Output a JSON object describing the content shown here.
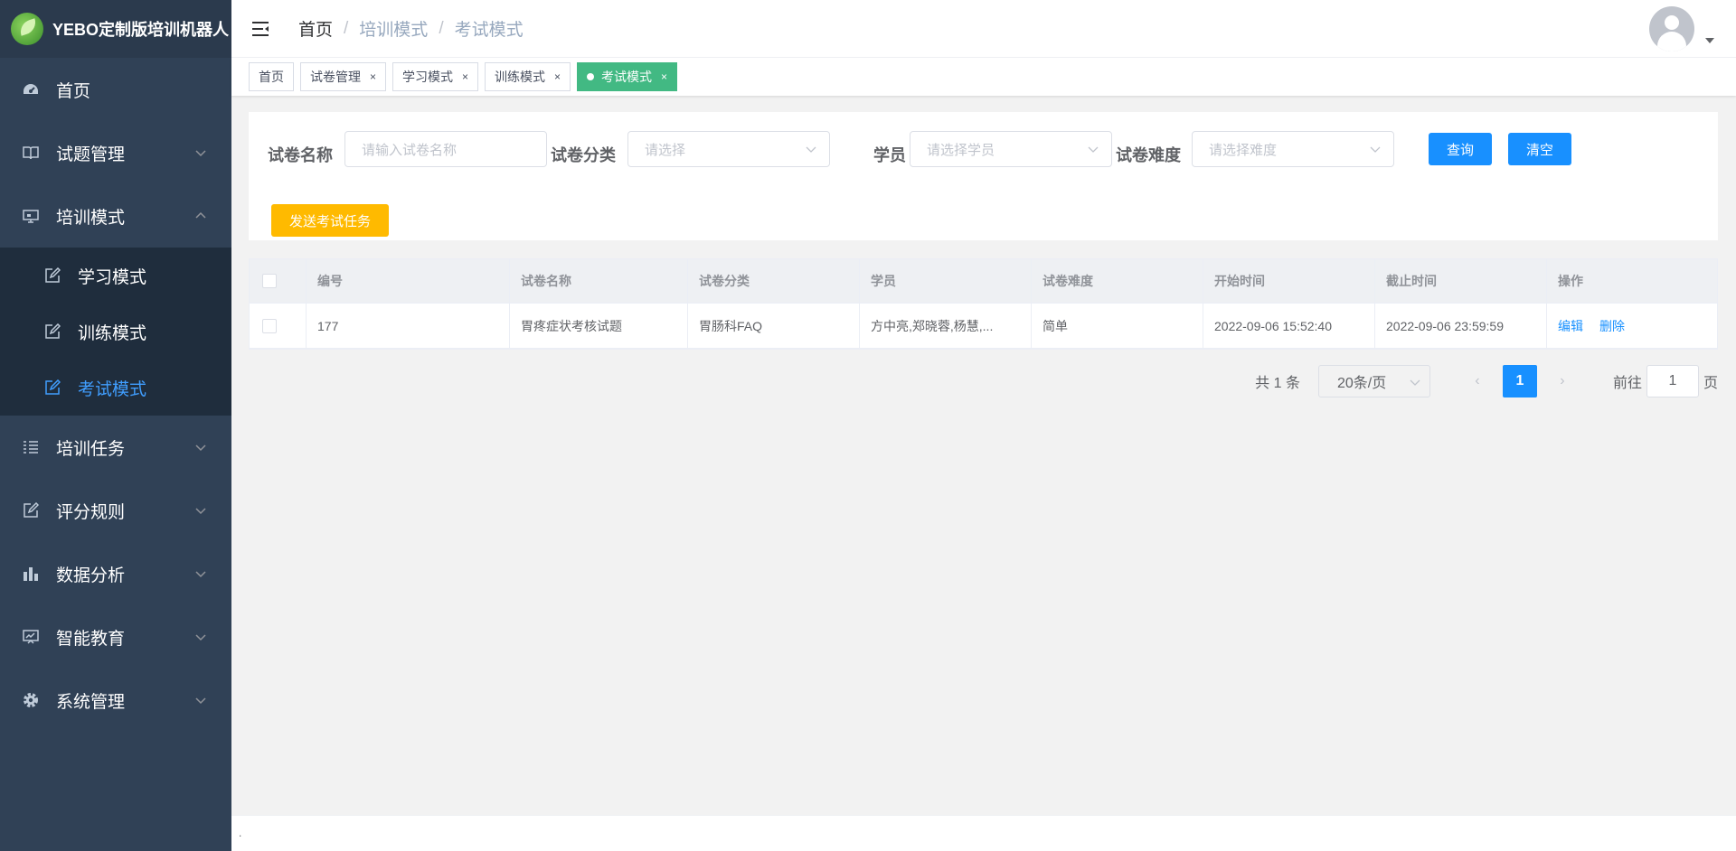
{
  "app": {
    "title": "YEBO定制版培训机器人"
  },
  "sidebar": {
    "items": [
      {
        "label": "首页",
        "icon": "dashboard-icon"
      },
      {
        "label": "试题管理",
        "icon": "book-icon"
      },
      {
        "label": "培训模式",
        "icon": "monitor-icon",
        "expanded": true,
        "children": [
          {
            "label": "学习模式",
            "icon": "edit-icon"
          },
          {
            "label": "训练模式",
            "icon": "edit-icon"
          },
          {
            "label": "考试模式",
            "icon": "edit-icon",
            "active": true
          }
        ]
      },
      {
        "label": "培训任务",
        "icon": "list-icon"
      },
      {
        "label": "评分规则",
        "icon": "edit-icon"
      },
      {
        "label": "数据分析",
        "icon": "bar-chart-icon"
      },
      {
        "label": "智能教育",
        "icon": "presentation-icon"
      },
      {
        "label": "系统管理",
        "icon": "gear-icon"
      }
    ]
  },
  "navbar": {
    "breadcrumb": [
      "首页",
      "培训模式",
      "考试模式"
    ],
    "separator": "/"
  },
  "tags": [
    {
      "label": "首页",
      "closable": false
    },
    {
      "label": "试卷管理",
      "closable": true
    },
    {
      "label": "学习模式",
      "closable": true
    },
    {
      "label": "训练模式",
      "closable": true
    },
    {
      "label": "考试模式",
      "closable": true,
      "active": true
    }
  ],
  "tag_close": "×",
  "filter": {
    "name_label": "试卷名称",
    "name_placeholder": "请输入试卷名称",
    "category_label": "试卷分类",
    "category_placeholder": "请选择",
    "student_label": "学员",
    "student_placeholder": "请选择学员",
    "difficulty_label": "试卷难度",
    "difficulty_placeholder": "请选择难度",
    "query_button": "查询",
    "clear_button": "清空",
    "send_button": "发送考试任务"
  },
  "table": {
    "columns": [
      "编号",
      "试卷名称",
      "试卷分类",
      "学员",
      "试卷难度",
      "开始时间",
      "截止时间",
      "操作"
    ],
    "rows": [
      {
        "id": "177",
        "name": "胃疼症状考核试题",
        "category": "胃肠科FAQ",
        "students": "方中亮,郑晓蓉,杨慧,...",
        "difficulty": "简单",
        "start": "2022-09-06 15:52:40",
        "end": "2022-09-06 23:59:59",
        "actions": [
          "编辑",
          "删除"
        ]
      }
    ]
  },
  "pagination": {
    "total_text": "共 1 条",
    "page_size": "20条/页",
    "prev": "‹",
    "next": "›",
    "current_page": "1",
    "goto_label": "前往",
    "goto_value": "1",
    "goto_suffix": "页"
  },
  "footer": {
    "text": "."
  },
  "colors": {
    "sidebar": "#304156",
    "accent": "#1890ff",
    "active_tag": "#42b983",
    "warning": "#ffba00"
  }
}
